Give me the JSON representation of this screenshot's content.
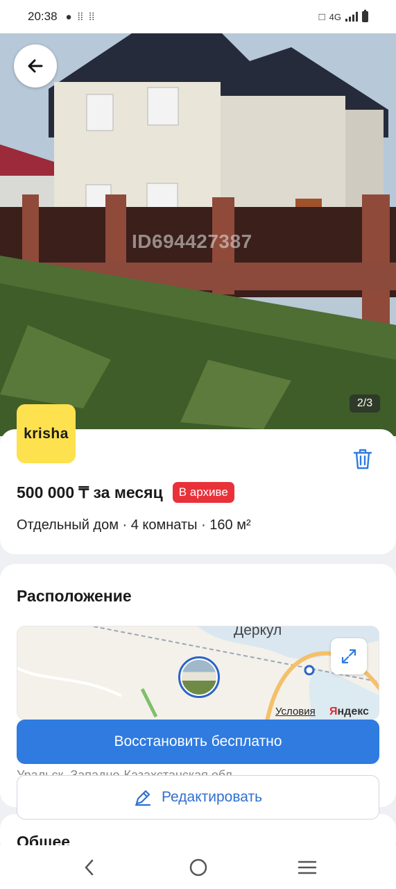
{
  "status_bar": {
    "time": "20:38",
    "network": "4G",
    "notification_icons": [
      "chat-icon",
      "footprints-icon",
      "footprints-icon"
    ]
  },
  "gallery": {
    "watermark": "ID694427387",
    "counter": "2/3"
  },
  "listing": {
    "brand": "krisha",
    "price": "500 000 ₸ за месяц",
    "status_badge": "В архиве",
    "subtitle": "Отдельный дом · 4 комнаты · 160 м²"
  },
  "location": {
    "title": "Расположение",
    "map_city": "Деркул",
    "map_terms": "Условия",
    "map_brand_first": "Я",
    "map_brand_rest": "ндекс",
    "address": "Уральск, Западно-Казахстанская обл."
  },
  "actions": {
    "restore": "Восстановить бесплатно",
    "edit": "Редактировать"
  },
  "next_section": {
    "title": "Общее"
  },
  "colors": {
    "accent": "#2f7be0",
    "badge": "#e9313a",
    "brand_yellow": "#fde14e"
  }
}
